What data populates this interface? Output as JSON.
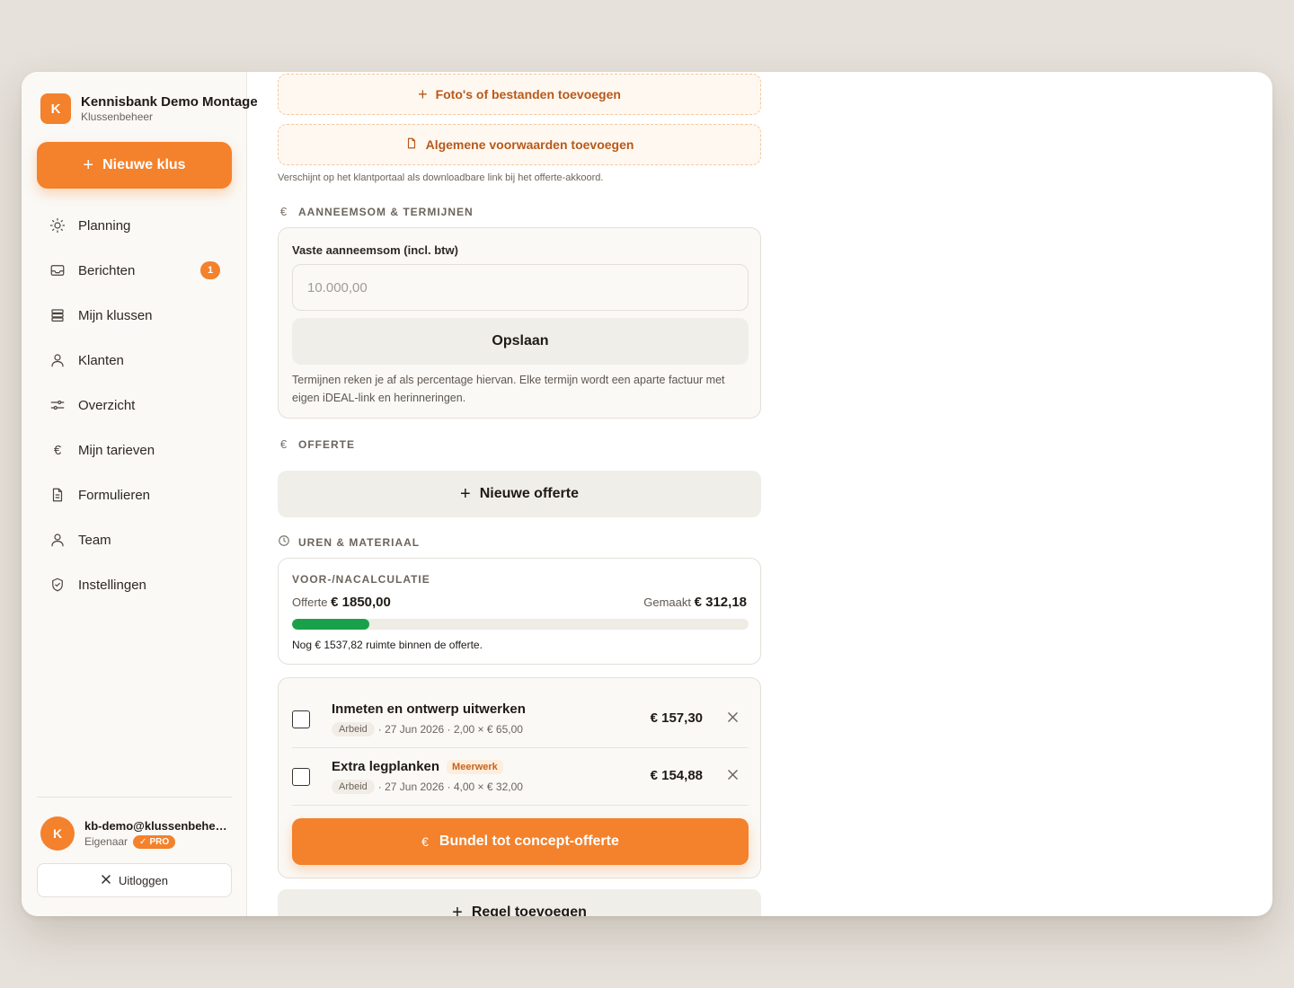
{
  "sidebar": {
    "brand": {
      "logo_letter": "K",
      "title": "Kennisbank Demo Montage",
      "subtitle": "Klussenbeheer"
    },
    "new_button": {
      "label": "Nieuwe klus",
      "icon": "plus-icon"
    },
    "nav": [
      {
        "label": "Planning",
        "icon": "sun-icon"
      },
      {
        "label": "Berichten",
        "icon": "inbox-icon",
        "badge": "1"
      },
      {
        "label": "Mijn klussen",
        "icon": "stack-icon"
      },
      {
        "label": "Klanten",
        "icon": "user-icon"
      },
      {
        "label": "Overzicht",
        "icon": "sliders-icon"
      },
      {
        "label": "Mijn tarieven",
        "icon": "euro-icon"
      },
      {
        "label": "Formulieren",
        "icon": "document-icon"
      },
      {
        "label": "Team",
        "icon": "user-icon"
      },
      {
        "label": "Instellingen",
        "icon": "shield-icon"
      }
    ],
    "user": {
      "avatar_letter": "K",
      "email": "kb-demo@klussenbeheer.nl",
      "role": "Eigenaar",
      "badge": "PRO"
    },
    "logout_label": "Uitloggen"
  },
  "main": {
    "add_files_label": "Foto's of bestanden toevoegen",
    "add_terms_label": "Algemene voorwaarden toevoegen",
    "terms_hint": "Verschijnt op het klantportaal als downloadbare link bij het offerte-akkoord.",
    "contract": {
      "section_title": "AANNEEMSOM & TERMIJNEN",
      "section_icon": "€",
      "field_label": "Vaste aanneemsom (incl. btw)",
      "field_placeholder": "10.000,00",
      "save_label": "Opslaan",
      "note": "Termijnen reken je af als percentage hiervan. Elke termijn wordt een aparte factuur met eigen iDEAL-link en herinneringen."
    },
    "quote": {
      "section_title": "OFFERTE",
      "section_icon": "€",
      "new_label": "Nieuwe offerte"
    },
    "hours": {
      "section_title": "UREN & MATERIAAL",
      "calc": {
        "title": "VOOR-/NACALCULATIE",
        "quote_label": "Offerte",
        "quote_value": "€ 1850,00",
        "made_label": "Gemaakt",
        "made_value": "€ 312,18",
        "progress_fraction": 0.1687,
        "progress_color": "#1aa04a",
        "note": "Nog € 1537,82 ruimte binnen de offerte."
      },
      "rows": [
        {
          "title": "Inmeten en ontwerp uitwerken",
          "badge": "",
          "tag": "Arbeid",
          "meta": "· 27 Jun 2026 · 2,00 × € 65,00",
          "amount": "€ 157,30"
        },
        {
          "title": "Extra legplanken",
          "badge": "Meerwerk",
          "tag": "Arbeid",
          "meta": "· 27 Jun 2026 · 4,00 × € 32,00",
          "amount": "€ 154,88"
        }
      ],
      "bundle_label": "Bundel tot concept-offerte",
      "bundle_icon": "€",
      "add_row_label": "Regel toevoegen"
    }
  },
  "colors": {
    "accent": "#f4812b",
    "success": "#1aa04a",
    "background": "#e6e1da"
  }
}
